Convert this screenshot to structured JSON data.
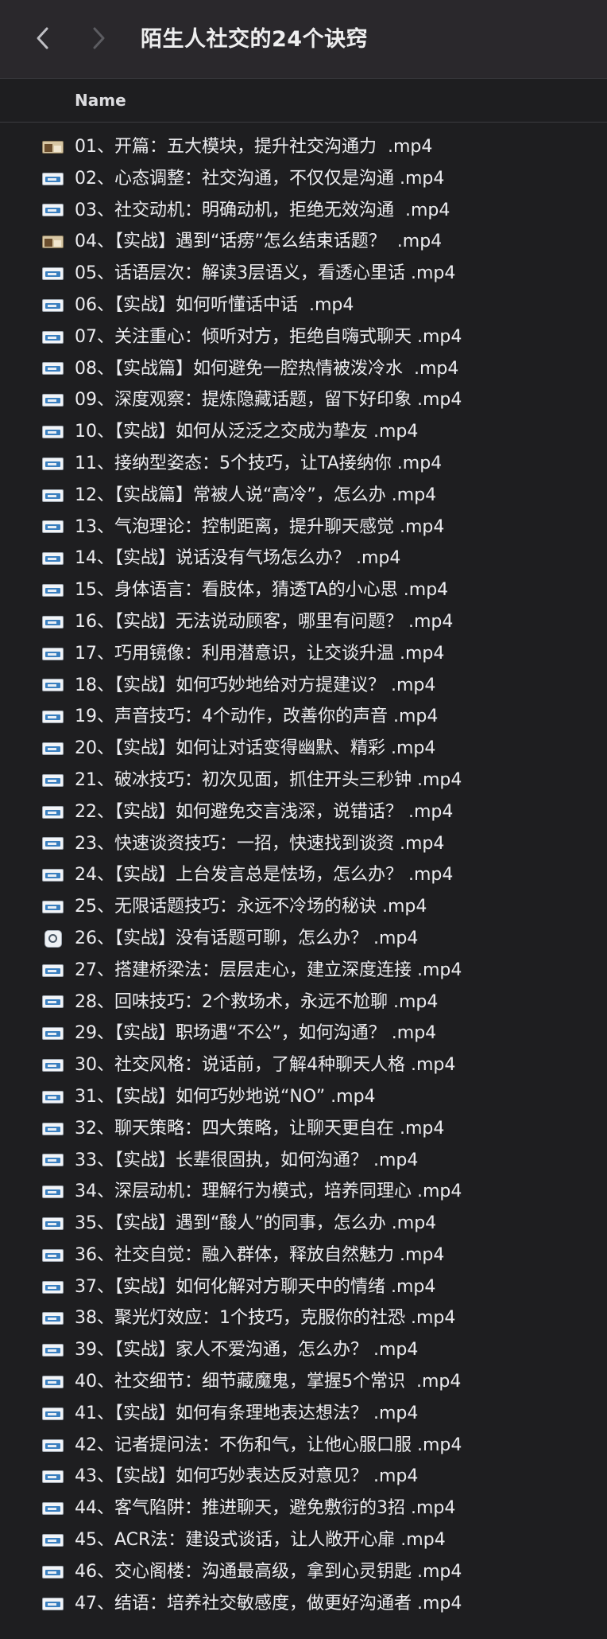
{
  "window": {
    "title": "陌生人社交的24个诀窍"
  },
  "nav": {
    "back_icon": "chevron-left-icon",
    "forward_icon": "chevron-right-icon"
  },
  "columns": {
    "name": "Name"
  },
  "files": [
    {
      "name": "01、开篇：五大模块，提升社交沟通力  .mp4",
      "icon": "photo"
    },
    {
      "name": "02、心态调整：社交沟通，不仅仅是沟通 .mp4",
      "icon": "video"
    },
    {
      "name": "03、社交动机：明确动机，拒绝无效沟通  .mp4",
      "icon": "video"
    },
    {
      "name": "04、【实战】遇到“话痨”怎么结束话题？  .mp4",
      "icon": "photo"
    },
    {
      "name": "05、话语层次：解读3层语义，看透心里话 .mp4",
      "icon": "video"
    },
    {
      "name": "06、【实战】如何听懂话中话  .mp4",
      "icon": "video"
    },
    {
      "name": "07、关注重心：倾听对方，拒绝自嗨式聊天 .mp4",
      "icon": "video"
    },
    {
      "name": "08、【实战篇】如何避免一腔热情被泼冷水  .mp4",
      "icon": "video"
    },
    {
      "name": "09、深度观察：提炼隐藏话题，留下好印象 .mp4",
      "icon": "video"
    },
    {
      "name": "10、【实战】如何从泛泛之交成为挚友 .mp4",
      "icon": "video"
    },
    {
      "name": "11、接纳型姿态：5个技巧，让TA接纳你 .mp4",
      "icon": "video"
    },
    {
      "name": "12、【实战篇】常被人说“高冷”，怎么办 .mp4",
      "icon": "video"
    },
    {
      "name": "13、气泡理论：控制距离，提升聊天感觉 .mp4",
      "icon": "video"
    },
    {
      "name": "14、【实战】说话没有气场怎么办？ .mp4",
      "icon": "video"
    },
    {
      "name": "15、身体语言：看肢体，猜透TA的小心思 .mp4",
      "icon": "video"
    },
    {
      "name": "16、【实战】无法说动顾客，哪里有问题？ .mp4",
      "icon": "video"
    },
    {
      "name": "17、巧用镜像：利用潜意识，让交谈升温 .mp4",
      "icon": "video"
    },
    {
      "name": "18、【实战】如何巧妙地给对方提建议？ .mp4",
      "icon": "video"
    },
    {
      "name": "19、声音技巧：4个动作，改善你的声音 .mp4",
      "icon": "video"
    },
    {
      "name": "20、【实战】如何让对话变得幽默、精彩 .mp4",
      "icon": "video"
    },
    {
      "name": "21、破冰技巧：初次见面，抓住开头三秒钟 .mp4",
      "icon": "video"
    },
    {
      "name": "22、【实战】如何避免交言浅深，说错话？ .mp4",
      "icon": "video"
    },
    {
      "name": "23、快速谈资技巧：一招，快速找到谈资 .mp4",
      "icon": "video"
    },
    {
      "name": "24、【实战】上台发言总是怯场，怎么办？ .mp4",
      "icon": "video"
    },
    {
      "name": "25、无限话题技巧：永远不冷场的秘诀 .mp4",
      "icon": "video"
    },
    {
      "name": "26、【实战】没有话题可聊，怎么办？ .mp4",
      "icon": "doc"
    },
    {
      "name": "27、搭建桥梁法：层层走心，建立深度连接 .mp4",
      "icon": "video"
    },
    {
      "name": "28、回味技巧：2个救场术，永远不尬聊 .mp4",
      "icon": "video"
    },
    {
      "name": "29、【实战】职场遇“不公”，如何沟通？ .mp4",
      "icon": "video"
    },
    {
      "name": "30、社交风格：说话前，了解4种聊天人格 .mp4",
      "icon": "video"
    },
    {
      "name": "31、【实战】如何巧妙地说“NO” .mp4",
      "icon": "video"
    },
    {
      "name": "32、聊天策略：四大策略，让聊天更自在 .mp4",
      "icon": "video"
    },
    {
      "name": "33、【实战】长辈很固执，如何沟通？ .mp4",
      "icon": "video"
    },
    {
      "name": "34、深层动机：理解行为模式，培养同理心 .mp4",
      "icon": "video"
    },
    {
      "name": "35、【实战】遇到“酸人”的同事，怎么办 .mp4",
      "icon": "video"
    },
    {
      "name": "36、社交自觉：融入群体，释放自然魅力 .mp4",
      "icon": "video"
    },
    {
      "name": "37、【实战】如何化解对方聊天中的情绪 .mp4",
      "icon": "video"
    },
    {
      "name": "38、聚光灯效应：1个技巧，克服你的社恐 .mp4",
      "icon": "video"
    },
    {
      "name": "39、【实战】家人不爱沟通，怎么办？ .mp4",
      "icon": "video"
    },
    {
      "name": "40、社交细节：细节藏魔鬼，掌握5个常识  .mp4",
      "icon": "video"
    },
    {
      "name": "41、【实战】如何有条理地表达想法？ .mp4",
      "icon": "video"
    },
    {
      "name": "42、记者提问法：不伤和气，让他心服口服 .mp4",
      "icon": "video"
    },
    {
      "name": "43、【实战】如何巧妙表达反对意见？ .mp4",
      "icon": "video"
    },
    {
      "name": "44、客气陷阱：推进聊天，避免敷衍的3招 .mp4",
      "icon": "video"
    },
    {
      "name": "45、ACR法：建设式谈话，让人敞开心扉 .mp4",
      "icon": "video"
    },
    {
      "name": "46、交心阁楼：沟通最高级，拿到心灵钥匙 .mp4",
      "icon": "video"
    },
    {
      "name": "47、结语：培养社交敏感度，做更好沟通者 .mp4",
      "icon": "video"
    }
  ]
}
